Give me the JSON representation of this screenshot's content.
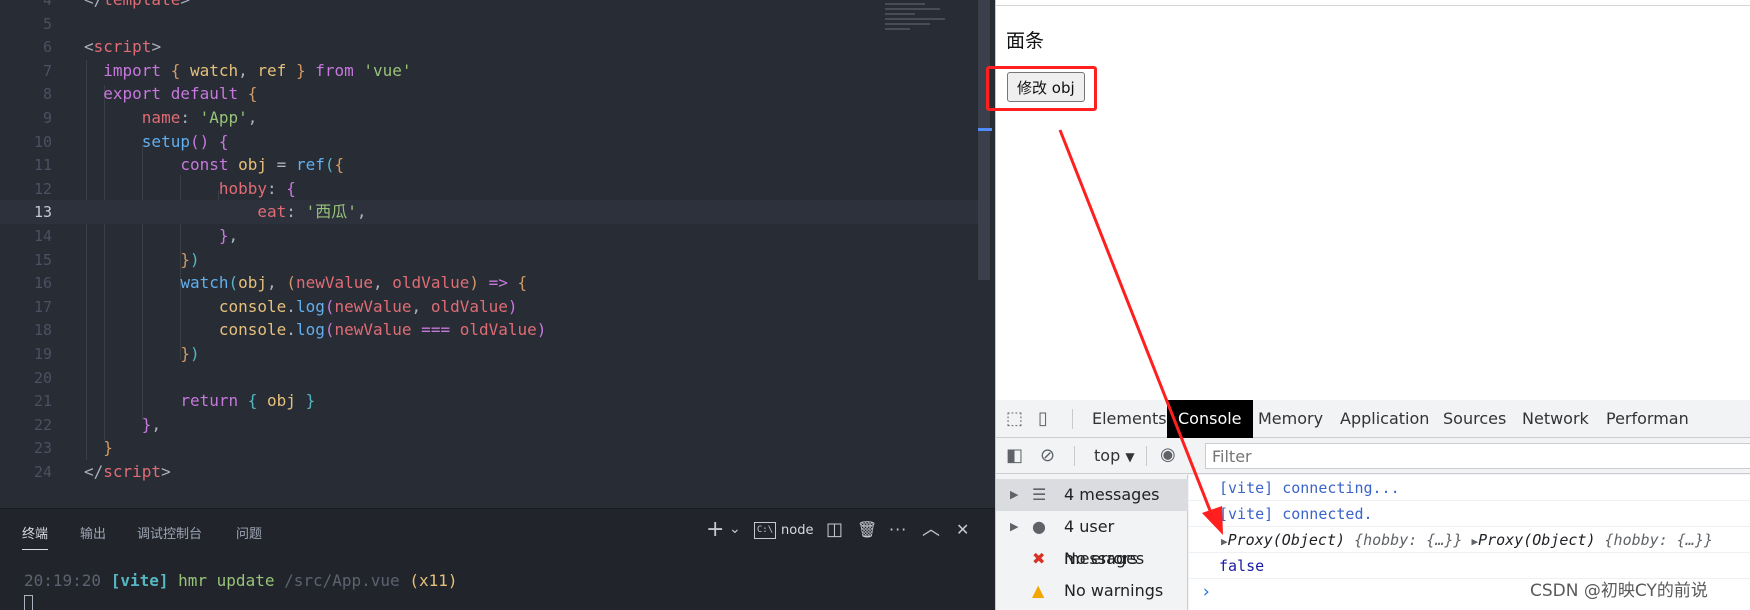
{
  "editor": {
    "lines": [
      {
        "n": "4",
        "tokens": [
          [
            "t-p",
            "</"
          ],
          [
            "t-tag",
            "template"
          ],
          [
            "t-p",
            ">"
          ]
        ]
      },
      {
        "n": "5",
        "tokens": []
      },
      {
        "n": "6",
        "tokens": [
          [
            "t-p",
            "<"
          ],
          [
            "t-tag",
            "script"
          ],
          [
            "t-p",
            ">"
          ]
        ]
      },
      {
        "n": "7",
        "tokens": [
          [
            "t-kw",
            "  import "
          ],
          [
            "t-br",
            "{ "
          ],
          [
            "t-var",
            "watch"
          ],
          [
            "t-p",
            ", "
          ],
          [
            "t-var",
            "ref"
          ],
          [
            "t-br",
            " }"
          ],
          [
            "t-kw",
            " from "
          ],
          [
            "t-str",
            "'vue'"
          ]
        ]
      },
      {
        "n": "8",
        "tokens": [
          [
            "t-kw",
            "  export default "
          ],
          [
            "t-br",
            "{"
          ]
        ]
      },
      {
        "n": "9",
        "tokens": [
          [
            "t-prop",
            "      name"
          ],
          [
            "t-p",
            ": "
          ],
          [
            "t-str",
            "'App'"
          ],
          [
            "t-p",
            ","
          ]
        ]
      },
      {
        "n": "10",
        "tokens": [
          [
            "t-fn",
            "      setup"
          ],
          [
            "t-br2",
            "()"
          ],
          [
            "t-p",
            " "
          ],
          [
            "t-br2",
            "{"
          ]
        ]
      },
      {
        "n": "11",
        "tokens": [
          [
            "t-kw",
            "          const "
          ],
          [
            "t-var",
            "obj"
          ],
          [
            "t-p",
            " = "
          ],
          [
            "t-fn",
            "ref"
          ],
          [
            "t-br3",
            "("
          ],
          [
            "t-br",
            "{"
          ]
        ]
      },
      {
        "n": "12",
        "tokens": [
          [
            "t-prop",
            "              hobby"
          ],
          [
            "t-p",
            ": "
          ],
          [
            "t-br2",
            "{"
          ]
        ]
      },
      {
        "n": "13",
        "tokens": [
          [
            "t-prop",
            "                  eat"
          ],
          [
            "t-p",
            ": "
          ],
          [
            "t-str",
            "'西瓜'"
          ],
          [
            "t-p",
            ","
          ]
        ]
      },
      {
        "n": "14",
        "tokens": [
          [
            "t-br2",
            "              }"
          ],
          [
            "t-p",
            ","
          ]
        ]
      },
      {
        "n": "15",
        "tokens": [
          [
            "t-br",
            "          }"
          ],
          [
            "t-br3",
            ")"
          ]
        ]
      },
      {
        "n": "16",
        "tokens": [
          [
            "t-fn",
            "          watch"
          ],
          [
            "t-br3",
            "("
          ],
          [
            "t-var",
            "obj"
          ],
          [
            "t-p",
            ", "
          ],
          [
            "t-br",
            "("
          ],
          [
            "t-param",
            "newValue"
          ],
          [
            "t-p",
            ", "
          ],
          [
            "t-param",
            "oldValue"
          ],
          [
            "t-br",
            ")"
          ],
          [
            "t-op",
            " => "
          ],
          [
            "t-br",
            "{"
          ]
        ]
      },
      {
        "n": "17",
        "tokens": [
          [
            "t-obj",
            "              console"
          ],
          [
            "t-p",
            "."
          ],
          [
            "t-fn",
            "log"
          ],
          [
            "t-br2",
            "("
          ],
          [
            "t-param",
            "newValue"
          ],
          [
            "t-p",
            ", "
          ],
          [
            "t-param",
            "oldValue"
          ],
          [
            "t-br2",
            ")"
          ]
        ]
      },
      {
        "n": "18",
        "tokens": [
          [
            "t-obj",
            "              console"
          ],
          [
            "t-p",
            "."
          ],
          [
            "t-fn",
            "log"
          ],
          [
            "t-br2",
            "("
          ],
          [
            "t-param",
            "newValue"
          ],
          [
            "t-op",
            " === "
          ],
          [
            "t-param",
            "oldValue"
          ],
          [
            "t-br2",
            ")"
          ]
        ]
      },
      {
        "n": "19",
        "tokens": [
          [
            "t-br",
            "          }"
          ],
          [
            "t-br3",
            ")"
          ]
        ]
      },
      {
        "n": "20",
        "tokens": []
      },
      {
        "n": "21",
        "tokens": [
          [
            "t-kw",
            "          return "
          ],
          [
            "t-br3",
            "{ "
          ],
          [
            "t-var",
            "obj"
          ],
          [
            "t-br3",
            " }"
          ]
        ]
      },
      {
        "n": "22",
        "tokens": [
          [
            "t-br2",
            "      }"
          ],
          [
            "t-p",
            ","
          ]
        ]
      },
      {
        "n": "23",
        "tokens": [
          [
            "t-br",
            "  }"
          ]
        ]
      },
      {
        "n": "24",
        "tokens": [
          [
            "t-p",
            "</"
          ],
          [
            "t-tag",
            "script"
          ],
          [
            "t-p",
            ">"
          ]
        ]
      }
    ],
    "active_line": "13"
  },
  "panel": {
    "tabs": [
      "终端",
      "输出",
      "调试控制台",
      "问题"
    ],
    "active_tab": "终端",
    "add_icon": "+",
    "chevron_icon": "⌄",
    "shell_icon_text": "C:\\",
    "shell_label": "node",
    "split_icon": "◫",
    "trash_icon": "🗑",
    "more_icon": "···",
    "maximize_icon": "︿",
    "close_icon": "✕",
    "terminal": {
      "time": "20:19:20",
      "tag": "[vite]",
      "msg": " hmr update ",
      "path": "/src/App.vue",
      "count": " (x11)"
    }
  },
  "page": {
    "text": "面条",
    "button_label": "修改 obj"
  },
  "devtools": {
    "tabs": [
      "Elements",
      "Console",
      "Memory",
      "Application",
      "Sources",
      "Network",
      "Performan"
    ],
    "active_tab": "Console",
    "context": "top",
    "filter_placeholder": "Filter",
    "sidebar": [
      {
        "label": "4 messages",
        "icon": "☰",
        "arrow": "▶",
        "color": "#5f6368"
      },
      {
        "label": "4 user messages",
        "icon": "●",
        "arrow": "▶",
        "color": "#5f6368"
      },
      {
        "label": "No errors",
        "icon": "✖",
        "arrow": "",
        "color": "#d93025"
      },
      {
        "label": "No warnings",
        "icon": "▲",
        "arrow": "",
        "color": "#f2a600"
      }
    ],
    "console": {
      "line1": "[vite] connecting...",
      "line2": "[vite] connected.",
      "obj_a": "Proxy(Object) ",
      "obj_a_detail": "{hobby: {…}}",
      "obj_b": "Proxy(Object) ",
      "obj_b_detail": "{hobby: {…}}",
      "line4": "false",
      "prompt": "›"
    }
  },
  "watermark": "CSDN @初映CY的前说",
  "colors": {
    "editor_bg": "#282c34",
    "panel_bg": "#21252b",
    "highlight_red": "#ff1f1f",
    "devtools_bg": "#f1f3f4"
  }
}
